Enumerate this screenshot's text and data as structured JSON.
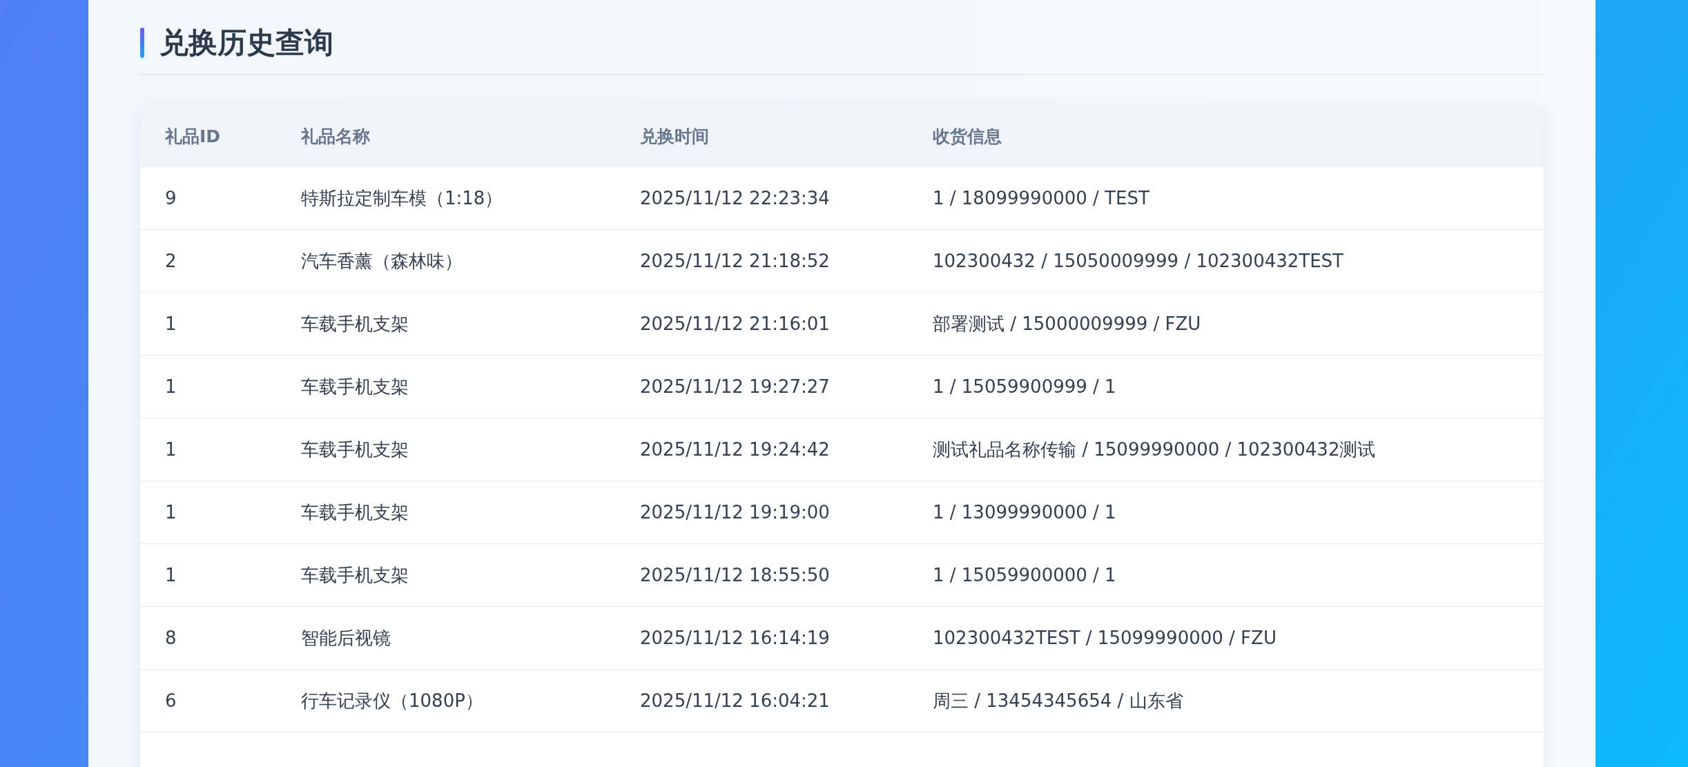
{
  "title": "兑换历史查询",
  "table": {
    "columns": [
      "礼品ID",
      "礼品名称",
      "兑换时间",
      "收货信息"
    ],
    "rows": [
      [
        "9",
        "特斯拉定制车模（1:18）",
        "2025/11/12 22:23:34",
        "1 / 18099990000 / TEST"
      ],
      [
        "2",
        "汽车香薰（森林味）",
        "2025/11/12 21:18:52",
        "102300432 / 15050009999 / 102300432TEST"
      ],
      [
        "1",
        "车载手机支架",
        "2025/11/12 21:16:01",
        "部署测试 / 15000009999 / FZU"
      ],
      [
        "1",
        "车载手机支架",
        "2025/11/12 19:27:27",
        "1 / 15059900999 / 1"
      ],
      [
        "1",
        "车载手机支架",
        "2025/11/12 19:24:42",
        "测试礼品名称传输 / 15099990000 / 102300432测试"
      ],
      [
        "1",
        "车载手机支架",
        "2025/11/12 19:19:00",
        "1 / 13099990000 / 1"
      ],
      [
        "1",
        "车载手机支架",
        "2025/11/12 18:55:50",
        "1 / 15059900000 / 1"
      ],
      [
        "8",
        "智能后视镜",
        "2025/11/12 16:14:19",
        "102300432TEST / 15099990000 / FZU"
      ],
      [
        "6",
        "行车记录仪（1080P）",
        "2025/11/12 16:04:21",
        "周三 / 13454345654 / 山东省"
      ]
    ]
  }
}
